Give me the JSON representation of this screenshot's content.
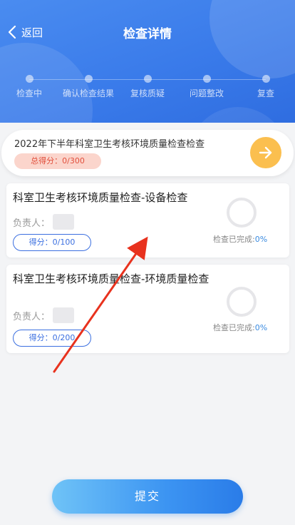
{
  "nav": {
    "back_label": "返回",
    "title": "检查详情"
  },
  "steps": [
    {
      "label": "检查中"
    },
    {
      "label": "确认检查结果"
    },
    {
      "label": "复核质疑"
    },
    {
      "label": "问题整改"
    },
    {
      "label": "复查"
    }
  ],
  "summary": {
    "title": "2022年下半年科室卫生考核环境质量检查检查",
    "score": "总得分：0/300"
  },
  "cards": [
    {
      "title": "科室卫生考核环境质量检查-设备检查",
      "owner_label": "负责人：",
      "score": "得分：0/100",
      "progress_label": "检查已完成:",
      "progress_value": "0%"
    },
    {
      "title": "科室卫生考核环境质量检查-环境质量检查",
      "owner_label": "负责人：",
      "score": "得分：0/200",
      "progress_label": "检查已完成:",
      "progress_value": "0%"
    }
  ],
  "submit_label": "提交",
  "colors": {
    "header": "#3a7bea",
    "accent": "#3b6fe0",
    "arrow_button": "#fbbf4f",
    "annotation": "#e8321e"
  }
}
